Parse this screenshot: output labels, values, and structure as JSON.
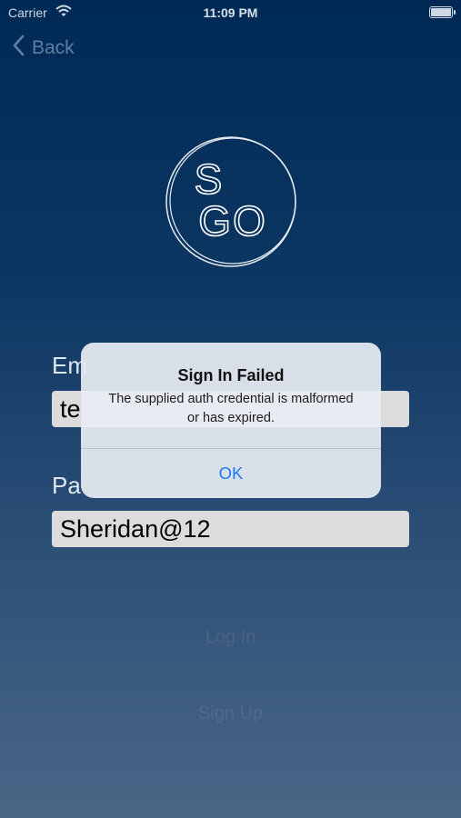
{
  "status_bar": {
    "carrier": "Carrier",
    "time": "11:09 PM"
  },
  "nav": {
    "back_label": "Back"
  },
  "logo": {
    "line1": "S",
    "line2": "GO"
  },
  "form": {
    "email_label": "Em",
    "email_value": "te",
    "password_label": "Pa",
    "password_value": "Sheridan@12",
    "login_label": "Log In",
    "signup_label": "Sign Up"
  },
  "alert": {
    "title": "Sign In Failed",
    "message": "The supplied auth credential is malformed or has expired.",
    "ok_label": "OK"
  },
  "colors": {
    "background_top": "#002a55",
    "background_bottom": "#4a6787",
    "alert_action": "#1d7cf2"
  }
}
